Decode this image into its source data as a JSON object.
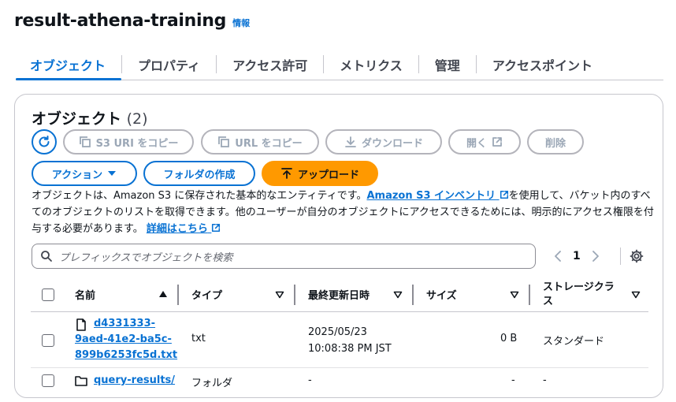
{
  "bucket": {
    "name": "result-athena-training",
    "info_label": "情報"
  },
  "tabs": [
    {
      "label": "オブジェクト",
      "active": true
    },
    {
      "label": "プロパティ"
    },
    {
      "label": "アクセス許可"
    },
    {
      "label": "メトリクス"
    },
    {
      "label": "管理"
    },
    {
      "label": "アクセスポイント"
    }
  ],
  "panel": {
    "title": "オブジェクト",
    "count": "(2)",
    "buttons": {
      "copy_s3_uri": "S3 URI をコピー",
      "copy_url": "URL をコピー",
      "download": "ダウンロード",
      "open": "開く",
      "delete": "削除",
      "actions": "アクション",
      "create_folder": "フォルダの作成",
      "upload": "アップロード"
    },
    "description": {
      "part1": "オブジェクトは、Amazon S3 に保存された基本的なエンティティです。",
      "inventory_link": "Amazon S3 インベントリ",
      "part2": "を使用して、バケット内のすべてのオブジェクトのリストを取得できます。他のユーザーが自分のオブジェクトにアクセスできるためには、明示的にアクセス権限を付与する必要があります。",
      "details_link": "詳細はこちら"
    },
    "search": {
      "placeholder": "プレフィックスでオブジェクトを検索"
    },
    "pagination": {
      "page": "1"
    }
  },
  "table": {
    "headers": {
      "name": "名前",
      "type": "タイプ",
      "modified": "最終更新日時",
      "size": "サイズ",
      "storage": "ストレージクラス"
    },
    "rows": [
      {
        "name_line1": "d4331333-",
        "name_line2": "9aed-41e2-ba5c-",
        "name_line3": "899b6253fc5d.txt",
        "type": "txt",
        "modified_line1": "2025/05/23",
        "modified_line2": "10:08:38 PM JST",
        "size": "0 B",
        "storage": "スタンダード"
      },
      {
        "name": "query-results/",
        "type": "フォルダ",
        "modified": "-",
        "size": "-",
        "storage": "-"
      }
    ]
  },
  "colors": {
    "accent": "#0972d3",
    "primary": "#ff9900",
    "disabled": "#9ba7b6"
  }
}
